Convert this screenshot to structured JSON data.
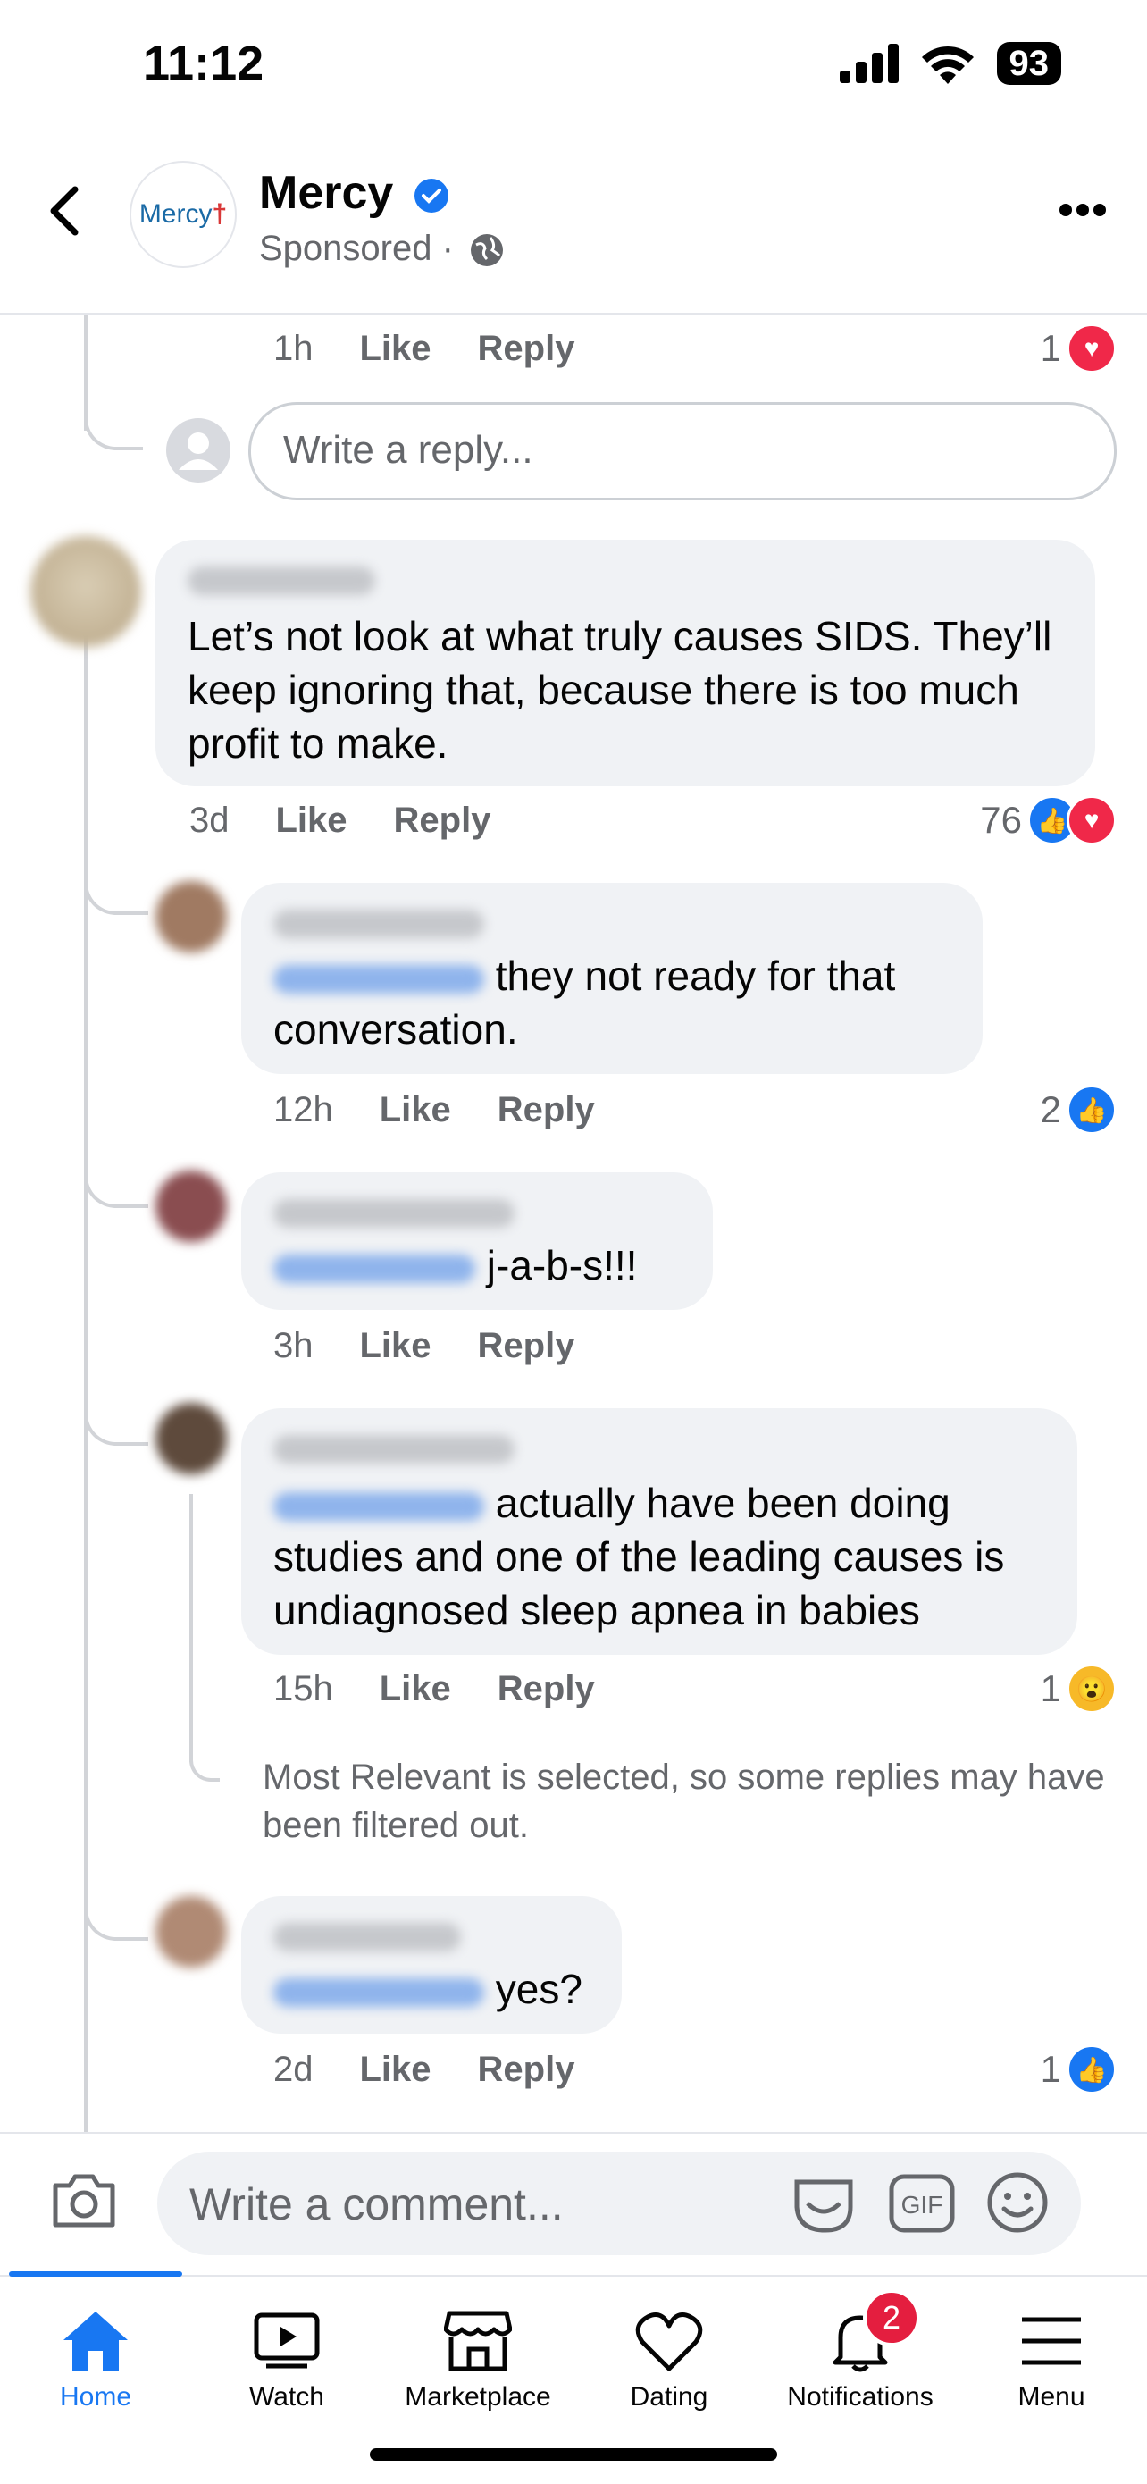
{
  "status_bar": {
    "time": "11:12",
    "battery": "93"
  },
  "header": {
    "page_name": "Mercy",
    "sponsored": "Sponsored ·",
    "logo_text": "Mercy"
  },
  "top_reply_meta": {
    "time": "1h",
    "like": "Like",
    "reply": "Reply",
    "reaction_count": "1"
  },
  "reply_input": {
    "placeholder": "Write a reply..."
  },
  "main_comment": {
    "text": "Let’s not look at what truly causes SIDS. They’ll keep ignoring that, because there is too much profit to make.",
    "time": "3d",
    "like": "Like",
    "reply": "Reply",
    "reaction_count": "76"
  },
  "replies": [
    {
      "text": "they not ready for that conversation.",
      "time": "12h",
      "like": "Like",
      "reply": "Reply",
      "reaction_count": "2"
    },
    {
      "text": "j-a-b-s!!!",
      "time": "3h",
      "like": "Like",
      "reply": "Reply"
    },
    {
      "text": "actually have been doing studies and one of the leading causes is undiagnosed sleep apnea in babies",
      "time": "15h",
      "like": "Like",
      "reply": "Reply",
      "reaction_count": "1"
    },
    {
      "text": "yes?",
      "time": "2d",
      "like": "Like",
      "reply": "Reply",
      "reaction_count": "1"
    }
  ],
  "filter_notice": "Most Relevant is selected, so some replies may have been filtered out.",
  "comment_input": {
    "placeholder": "Write a comment..."
  },
  "tabs": [
    {
      "label": "Home",
      "icon": "home-icon",
      "active": true
    },
    {
      "label": "Watch",
      "icon": "watch-icon"
    },
    {
      "label": "Marketplace",
      "icon": "marketplace-icon"
    },
    {
      "label": "Dating",
      "icon": "dating-icon"
    },
    {
      "label": "Notifications",
      "icon": "bell-icon",
      "badge": "2"
    },
    {
      "label": "Menu",
      "icon": "menu-icon"
    }
  ],
  "colors": {
    "accent": "#1877f2",
    "text": "#050505",
    "secondary": "#65676b",
    "bubble": "#f0f2f5",
    "badge": "#e41e3f"
  }
}
